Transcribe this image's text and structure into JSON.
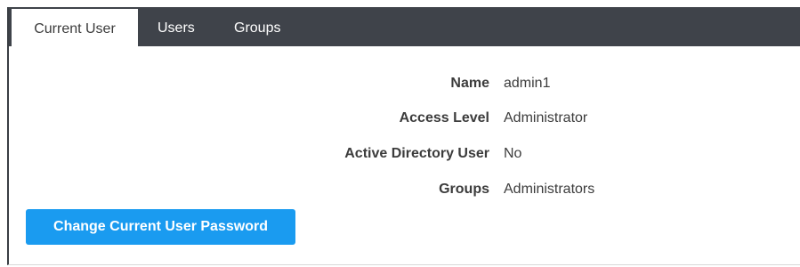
{
  "tabs": [
    {
      "label": "Current User",
      "active": true
    },
    {
      "label": "Users",
      "active": false
    },
    {
      "label": "Groups",
      "active": false
    }
  ],
  "fields": [
    {
      "label": "Name",
      "value": "admin1"
    },
    {
      "label": "Access Level",
      "value": "Administrator"
    },
    {
      "label": "Active Directory User",
      "value": "No"
    },
    {
      "label": "Groups",
      "value": "Administrators"
    }
  ],
  "actions": {
    "change_password_label": "Change Current User Password"
  },
  "colors": {
    "tabbar_bg": "#3f434a",
    "primary_button": "#1a9bf0",
    "text": "#3c3c3c"
  }
}
